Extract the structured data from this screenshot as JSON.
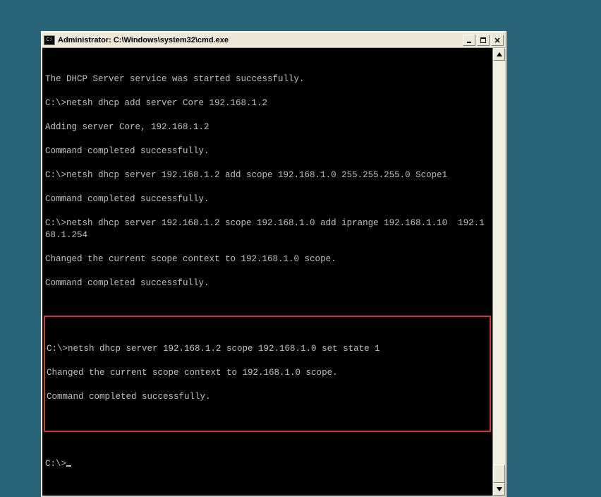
{
  "window": {
    "title": "Administrator: C:\\Windows\\system32\\cmd.exe",
    "icon_label": "C:\\"
  },
  "console": {
    "lines": [
      "The DHCP Server service was started successfully.",
      "",
      "C:\\>netsh dhcp add server Core 192.168.1.2",
      "",
      "Adding server Core, 192.168.1.2",
      "",
      "Command completed successfully.",
      "",
      "C:\\>netsh dhcp server 192.168.1.2 add scope 192.168.1.0 255.255.255.0 Scope1",
      "",
      "Command completed successfully.",
      "",
      "C:\\>netsh dhcp server 192.168.1.2 scope 192.168.1.0 add iprange 192.168.1.10  192.168.1.254",
      "",
      "Changed the current scope context to 192.168.1.0 scope.",
      "",
      "Command completed successfully."
    ],
    "highlighted_lines": [
      "C:\\>netsh dhcp server 192.168.1.2 scope 192.168.1.0 set state 1",
      "",
      "Changed the current scope context to 192.168.1.0 scope.",
      "",
      "Command completed successfully."
    ],
    "prompt": "C:\\>"
  },
  "colors": {
    "desktop_bg": "#2a6478",
    "console_bg": "#000000",
    "console_fg": "#c0c0c0",
    "highlight_border": "#d13a2a"
  }
}
